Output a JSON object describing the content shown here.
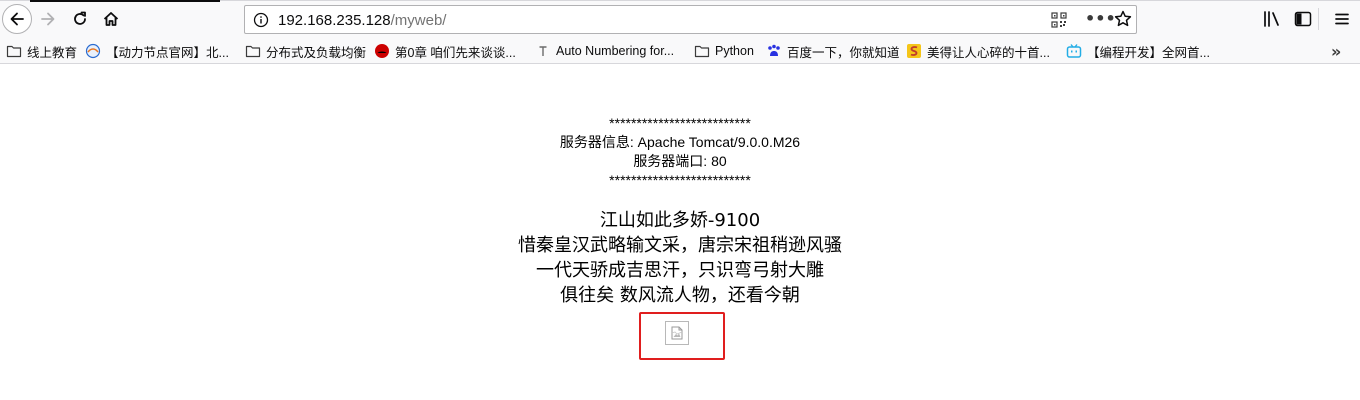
{
  "browser": {
    "url_host": "192.168.235.128",
    "url_path": "/myweb/",
    "more_glyph": "•••",
    "bookmarks_overflow_glyph": "»"
  },
  "bookmarks": [
    {
      "label": "线上教育",
      "icon": "folder-icon"
    },
    {
      "label": "【动力节点官网】北...",
      "icon": "site-favicon-icon"
    },
    {
      "label": "分布式及负载均衡",
      "icon": "folder-icon"
    },
    {
      "label": "第0章 咱们先来谈谈...",
      "icon": "redhat-favicon-icon"
    },
    {
      "label": "Auto Numbering for...",
      "icon": "site-favicon-icon"
    },
    {
      "label": "Python",
      "icon": "folder-icon"
    },
    {
      "label": "百度一下，你就知道",
      "icon": "baidu-favicon-icon"
    },
    {
      "label": "美得让人心碎的十首...",
      "icon": "site-favicon-icon"
    },
    {
      "label": "【编程开发】全网首...",
      "icon": "bilibili-favicon-icon"
    }
  ],
  "page": {
    "info": {
      "stars_top": "**************************",
      "server_info": "服务器信息: Apache Tomcat/9.0.0.M26",
      "server_port": "服务器端口: 80",
      "stars_bottom": "**************************"
    },
    "poem": [
      "江山如此多娇-9100",
      "惜秦皇汉武略输文采，唐宗宋祖稍逊风骚",
      "一代天骄成吉思汗，只识弯弓射大雕",
      "俱往矣 数风流人物，还看今朝"
    ]
  },
  "colors": {
    "highlight_box": "#e01e1e",
    "toolbar_bg": "#f9f9fa"
  }
}
